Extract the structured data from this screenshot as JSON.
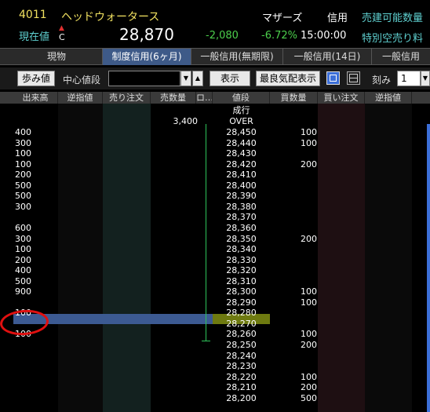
{
  "header": {
    "code": "4011",
    "name": "ヘッドウォータース",
    "market": "マザーズ",
    "credit": "信用",
    "available_label": "売建可能数量",
    "current_label": "現在値",
    "arrow": "▲",
    "flag": "C",
    "price": "28,870",
    "change": "-2,080",
    "change_pct": "-6.72%",
    "time": "15:00:00",
    "special_label": "特別空売り料"
  },
  "tabs": [
    "現物",
    "制度信用(6ヶ月)",
    "一般信用(無期限)",
    "一般信用(14日)",
    "一般信用"
  ],
  "active_tab": 1,
  "toolbar": {
    "ayumi": "歩み値",
    "center_price_label": "中心値段",
    "center_price_value": "",
    "display_button": "表示",
    "best_quote_button": "最良気配表示",
    "tick_label": "刻み",
    "tick_value": "1",
    "dropdown_arrow": "▼",
    "up_arrow": "▲"
  },
  "columns": [
    "出来高",
    "逆指値",
    "売り注文",
    "売数量",
    "ロ…",
    "値段",
    "買数量",
    "買い注文",
    "逆指値"
  ],
  "market_order_label": "成行",
  "over_row": {
    "ask_qty": "3,400",
    "price": "OVER"
  },
  "rows": [
    {
      "vol": "400",
      "price": "28,450",
      "bid": "100"
    },
    {
      "vol": "300",
      "price": "28,440",
      "bid": "100"
    },
    {
      "vol": "100",
      "price": "28,430",
      "bid": ""
    },
    {
      "vol": "100",
      "price": "28,420",
      "bid": "200"
    },
    {
      "vol": "200",
      "price": "28,410",
      "bid": ""
    },
    {
      "vol": "500",
      "price": "28,400",
      "bid": ""
    },
    {
      "vol": "500",
      "price": "28,390",
      "bid": ""
    },
    {
      "vol": "300",
      "price": "28,380",
      "bid": ""
    },
    {
      "vol": "",
      "price": "28,370",
      "bid": ""
    },
    {
      "vol": "600",
      "price": "28,360",
      "bid": ""
    },
    {
      "vol": "300",
      "price": "28,350",
      "bid": "200"
    },
    {
      "vol": "100",
      "price": "28,340",
      "bid": ""
    },
    {
      "vol": "200",
      "price": "28,330",
      "bid": ""
    },
    {
      "vol": "400",
      "price": "28,320",
      "bid": ""
    },
    {
      "vol": "500",
      "price": "28,310",
      "bid": ""
    },
    {
      "vol": "900",
      "price": "28,300",
      "bid": "100"
    },
    {
      "vol": "",
      "price": "28,290",
      "bid": "100"
    },
    {
      "vol": "100",
      "price": "28,280",
      "bid": ""
    },
    {
      "vol": "",
      "price": "28,270",
      "bid": ""
    },
    {
      "vol": "100",
      "price": "28,260",
      "bid": "100"
    },
    {
      "vol": "",
      "price": "28,250",
      "bid": "200"
    },
    {
      "vol": "",
      "price": "28,240",
      "bid": ""
    },
    {
      "vol": "",
      "price": "28,230",
      "bid": ""
    },
    {
      "vol": "",
      "price": "28,220",
      "bid": "100"
    },
    {
      "vol": "",
      "price": "28,210",
      "bid": "200"
    },
    {
      "vol": "",
      "price": "28,200",
      "bid": "500"
    }
  ],
  "colors": {
    "accent": "#3c5a92",
    "price_highlight": "#6e7a10",
    "down": "#4cd04c",
    "annotation": "#e01010"
  }
}
